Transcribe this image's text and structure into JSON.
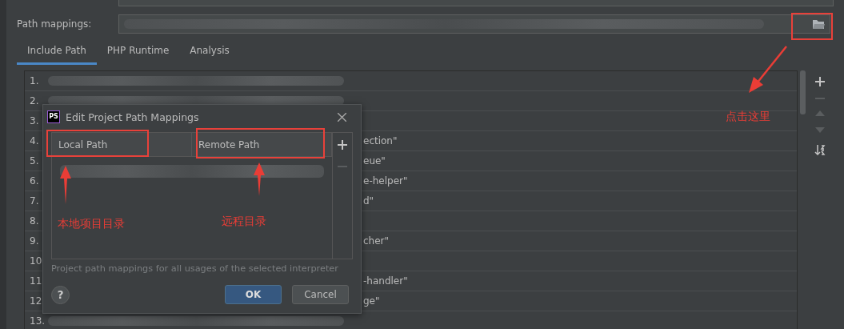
{
  "path_mappings": {
    "label": "Path mappings:"
  },
  "tabs": [
    {
      "label": "Include Path",
      "selected": true
    },
    {
      "label": "PHP Runtime",
      "selected": false
    },
    {
      "label": "Analysis",
      "selected": false
    }
  ],
  "include_paths": [
    {
      "number": "1.",
      "masked": true
    },
    {
      "number": "2.",
      "masked": true
    },
    {
      "number": "3."
    },
    {
      "number": "4.",
      "tail": "ection\""
    },
    {
      "number": "5.",
      "tail": "eue\""
    },
    {
      "number": "6.",
      "tail": "e-helper\""
    },
    {
      "number": "7.",
      "tail": "d\""
    },
    {
      "number": "8."
    },
    {
      "number": "9.",
      "tail": "cher\""
    },
    {
      "number": "10"
    },
    {
      "number": "11",
      "tail": "-handler\""
    },
    {
      "number": "12",
      "tail": "ge\""
    },
    {
      "number": "13.",
      "masked": true
    }
  ],
  "dialog": {
    "logo": "PS",
    "title": "Edit Project Path Mappings",
    "columns": [
      "Local Path",
      "Remote Path"
    ],
    "hint": "Project path mappings for all usages of the selected interpreter",
    "help": "?",
    "buttons": [
      {
        "label": "OK",
        "primary": true
      },
      {
        "label": "Cancel",
        "primary": false
      }
    ]
  },
  "annotations": [
    {
      "text": "点击这里"
    },
    {
      "text": "本地项目目录"
    },
    {
      "text": "远程目录"
    }
  ]
}
